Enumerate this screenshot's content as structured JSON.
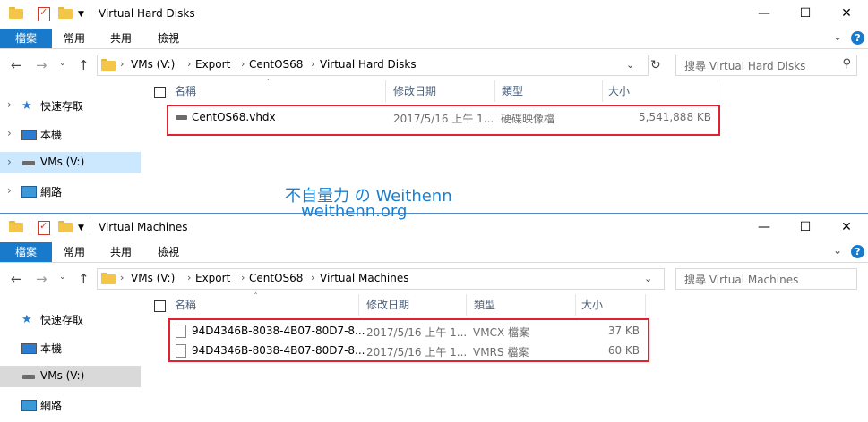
{
  "watermark": {
    "line1": "不自量力 の Weithenn",
    "line2": "weithenn.org"
  },
  "windows": [
    {
      "title": "Virtual Hard Disks",
      "ribbon_tabs": [
        "檔案",
        "常用",
        "共用",
        "檢視"
      ],
      "breadcrumb": [
        "VMs (V:)",
        "Export",
        "CentOS68",
        "Virtual Hard Disks"
      ],
      "search_placeholder": "搜尋 Virtual Hard Disks",
      "nav_items": [
        "快速存取",
        "本機",
        "VMs (V:)",
        "網路"
      ],
      "columns": [
        "名稱",
        "修改日期",
        "類型",
        "大小"
      ],
      "files": [
        {
          "name": "CentOS68.vhdx",
          "modified": "2017/5/16 上午 1...",
          "type": "硬碟映像檔",
          "size": "5,541,888 KB"
        }
      ]
    },
    {
      "title": "Virtual Machines",
      "ribbon_tabs": [
        "檔案",
        "常用",
        "共用",
        "檢視"
      ],
      "breadcrumb": [
        "VMs (V:)",
        "Export",
        "CentOS68",
        "Virtual Machines"
      ],
      "search_placeholder": "搜尋 Virtual Machines",
      "nav_items": [
        "快速存取",
        "本機",
        "VMs (V:)",
        "網路"
      ],
      "columns": [
        "名稱",
        "修改日期",
        "類型",
        "大小"
      ],
      "files": [
        {
          "name": "94D4346B-8038-4B07-80D7-8...",
          "modified": "2017/5/16 上午 1...",
          "type": "VMCX 檔案",
          "size": "37 KB"
        },
        {
          "name": "94D4346B-8038-4B07-80D7-8...",
          "modified": "2017/5/16 上午 1...",
          "type": "VMRS 檔案",
          "size": "60 KB"
        }
      ]
    }
  ],
  "icons": {
    "folder": "folder-icon",
    "properties": "properties-icon",
    "minimize": "minimize-icon",
    "maximize": "maximize-icon",
    "close": "close-icon",
    "help": "help-icon",
    "back": "back-arrow-icon",
    "forward": "forward-arrow-icon",
    "up": "up-arrow-icon",
    "refresh": "refresh-icon",
    "search": "search-icon",
    "quick_access": "star-icon",
    "this_pc": "computer-icon",
    "drive": "drive-icon",
    "network": "network-icon",
    "vhdx": "disk-image-icon",
    "file": "file-icon"
  },
  "colors": {
    "accent": "#1979ca",
    "highlight_box": "#e0222e",
    "selected_nav_active": "#cce8ff",
    "selected_nav_inactive": "#d9d9d9",
    "watermark": "#1a7fd0"
  }
}
